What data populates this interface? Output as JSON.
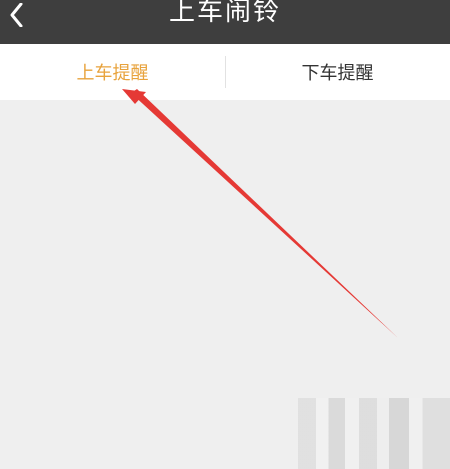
{
  "header": {
    "title": "上车闹铃",
    "back_icon": "chevron-left-icon",
    "background_color": "#3e3e3e"
  },
  "tabs": [
    {
      "label": "上车提醒",
      "active": true
    },
    {
      "label": "下车提醒",
      "active": false
    }
  ],
  "colors": {
    "active_tab": "#e8a33d",
    "inactive_tab": "#333333",
    "content_bg": "#efefef",
    "arrow": "#e53935"
  },
  "annotation": {
    "type": "arrow",
    "icon": "red-arrow-annotation"
  }
}
